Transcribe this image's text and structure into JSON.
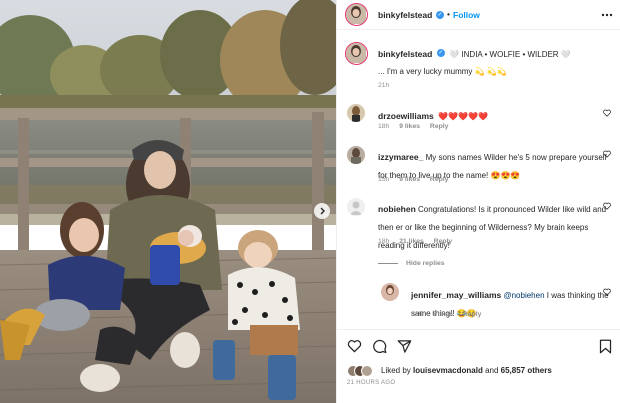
{
  "post": {
    "author": "binkyfelstead",
    "follow_label": "Follow",
    "separator": "•"
  },
  "caption": {
    "author": "binkyfelstead",
    "line1": "🤍 INDIA • WOLFIE • WILDER 🤍",
    "line2": "... I'm a very lucky mummy 💫 💫💫",
    "time": "21h"
  },
  "comments": [
    {
      "user": "drzoewilliams",
      "text": "❤️❤️❤️❤️❤️",
      "time": "18h",
      "likes": "9 likes",
      "reply": "Reply"
    },
    {
      "user": "izzymaree_",
      "text": "My sons names Wilder he's 5 now prepare yourself for them to live up to the name! 😍😍😍",
      "time": "15h",
      "likes": "9 likes",
      "reply": "Reply"
    },
    {
      "user": "nobiehen",
      "text": "Congratulations! Is it pronounced Wilder like wild and then er or like the beginning of Wilderness? My brain keeps reading it differently!",
      "time": "18h",
      "likes": "21 likes",
      "reply": "Reply"
    }
  ],
  "hide_replies": "Hide replies",
  "reply": {
    "user": "jennifer_may_williams",
    "mention": "@nobiehen",
    "text": " I was thinking the same thing!! 😂☺️",
    "time": "13h",
    "likes": "5 likes",
    "reply": "Reply"
  },
  "likes": {
    "prefix": "Liked by",
    "user": "louisevmacdonald",
    "middle": "and",
    "count": "65,857 others"
  },
  "timestamp": "21 HOURS AGO",
  "colors": {
    "accent": "#0095f6",
    "heart": "#ed4956",
    "muted": "#8e8e8e"
  }
}
